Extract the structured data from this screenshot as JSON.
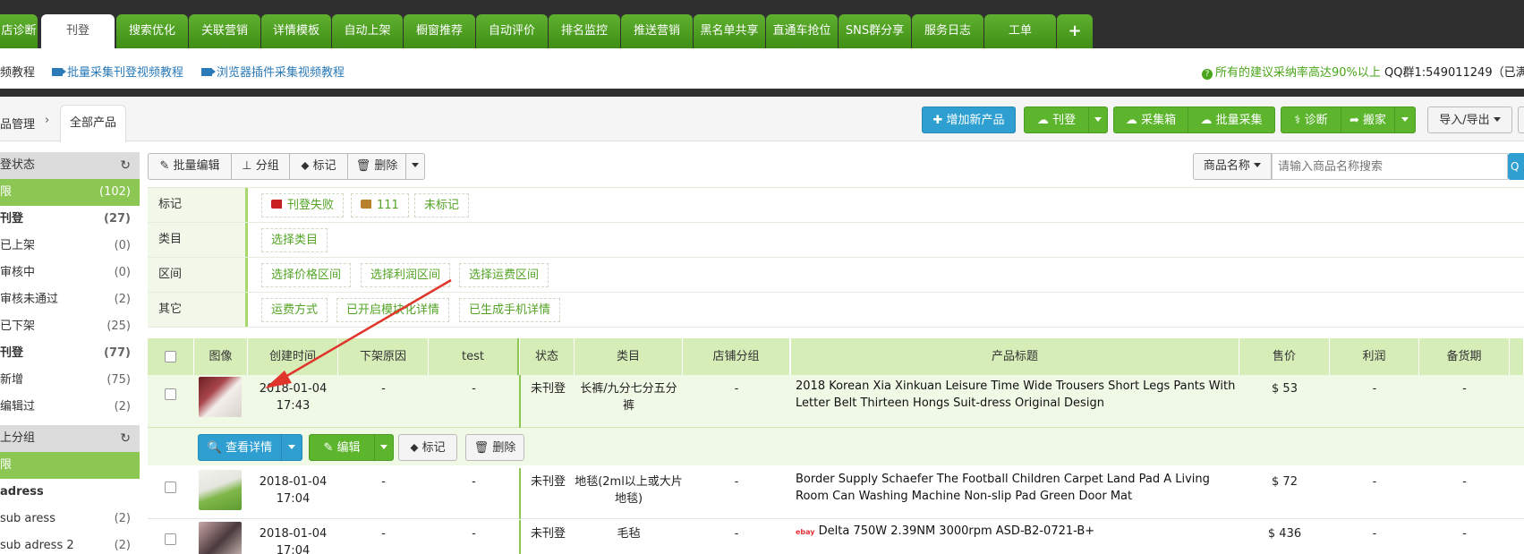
{
  "top_tabs": [
    {
      "label": "店诊断"
    },
    {
      "label": "刊登",
      "active": true
    },
    {
      "label": "搜索优化"
    },
    {
      "label": "关联营销"
    },
    {
      "label": "详情模板"
    },
    {
      "label": "自动上架"
    },
    {
      "label": "橱窗推荐"
    },
    {
      "label": "自动评价"
    },
    {
      "label": "排名监控"
    },
    {
      "label": "推送营销"
    },
    {
      "label": "黑名单共享"
    },
    {
      "label": "直通车抢位"
    },
    {
      "label": "SNS群分享"
    },
    {
      "label": "服务日志"
    },
    {
      "label": "工单"
    },
    {
      "label": "+"
    }
  ],
  "info_links": [
    "频教程",
    "批量采集刊登视频教程",
    "浏览器插件采集视频教程"
  ],
  "notice": {
    "text": "所有的建议采纳率高达90%以上",
    "qq": "QQ群1:549011249（已满"
  },
  "breadcrumb": {
    "parent": "品管理",
    "current": "全部产品"
  },
  "actions": {
    "add_product": "增加新产品",
    "publish": "刊登",
    "collect_box": "采集箱",
    "batch_collect": "批量采集",
    "diagnose": "诊断",
    "move": "搬家",
    "import_export": "导入/导出"
  },
  "sidebar": {
    "section1_title": "登状态",
    "section1_items": [
      {
        "label": "限",
        "count": "(102)",
        "active": true
      },
      {
        "label": "刊登",
        "count": "(27)",
        "bold": true
      },
      {
        "label": "已上架",
        "count": "(0)"
      },
      {
        "label": "审核中",
        "count": "(0)"
      },
      {
        "label": "审核未通过",
        "count": "(2)"
      },
      {
        "label": "已下架",
        "count": "(25)"
      },
      {
        "label": "刊登",
        "count": "(77)",
        "bold": true
      },
      {
        "label": "新增",
        "count": "(75)"
      },
      {
        "label": "编辑过",
        "count": "(2)"
      }
    ],
    "section2_title": "上分组",
    "section2_items": [
      {
        "label": "限",
        "count": "",
        "active": true
      },
      {
        "label": "adress",
        "count": "",
        "bold": true
      },
      {
        "label": "sub aress",
        "count": "(2)"
      },
      {
        "label": "sub adress 2",
        "count": "(2)"
      }
    ]
  },
  "toolbar": {
    "batch_edit": "批量编辑",
    "group": "分组",
    "mark": "标记",
    "delete": "删除"
  },
  "search": {
    "field": "商品名称",
    "placeholder": "请输入商品名称搜索"
  },
  "filters": [
    {
      "label": "标记",
      "chips": [
        "刊登失败",
        "111",
        "未标记"
      ]
    },
    {
      "label": "类目",
      "chips": [
        "选择类目"
      ]
    },
    {
      "label": "区间",
      "chips": [
        "选择价格区间",
        "选择利润区间",
        "选择运费区间"
      ]
    },
    {
      "label": "其它",
      "chips": [
        "运费方式",
        "已开启模块化详情",
        "已生成手机详情"
      ]
    }
  ],
  "table": {
    "headers": [
      "图像",
      "创建时间",
      "下架原因",
      "test",
      "状态",
      "类目",
      "店铺分组",
      "产品标题",
      "售价",
      "利润",
      "备货期"
    ],
    "rows": [
      {
        "created": "2018-01-04 17:43",
        "reason": "-",
        "test": "-",
        "status": "未刊登",
        "category": "长裤/九分七分五分裤",
        "group": "-",
        "title": "2018 Korean Xia Xinkuan Leisure Time Wide Trousers Short Legs Pants With Letter Belt Thirteen Hongs Suit-dress Original Design",
        "price": "$ 53",
        "profit": "-",
        "stock": "-"
      },
      {
        "created": "2018-01-04 17:04",
        "reason": "-",
        "test": "-",
        "status": "未刊登",
        "category": "地毯(2ml以上或大片地毯)",
        "group": "-",
        "title": "Border Supply Schaefer The Football Children Carpet Land Pad A Living Room Can Washing Machine Non-slip Pad Green Door Mat",
        "price": "$ 72",
        "profit": "-",
        "stock": "-"
      },
      {
        "created": "2018-01-04 17:04",
        "reason": "-",
        "test": "-",
        "status": "未刊登",
        "category": "毛毡",
        "group": "-",
        "title": "Delta  750W 2.39NM 3000rpm ASD-B2-0721-B+",
        "price": "$ 436",
        "profit": "-",
        "stock": "-",
        "badge": "ebay"
      }
    ],
    "row_actions": {
      "view": "查看详情",
      "edit": "编辑",
      "mark": "标记",
      "delete": "删除"
    }
  },
  "colors": {
    "green": "#5db52e",
    "blue": "#2e9fd0",
    "header_green": "#d6edb8",
    "arrow": "#e0352b"
  }
}
